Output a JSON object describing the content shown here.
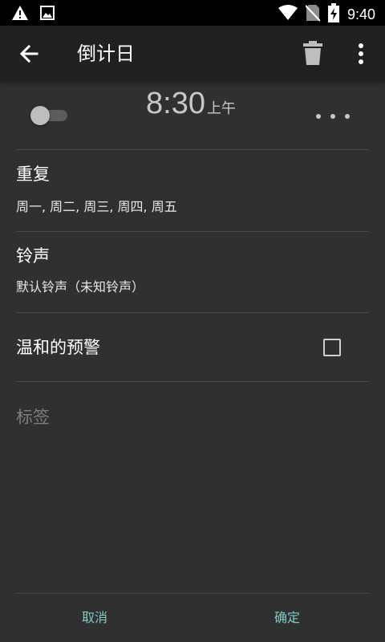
{
  "status_bar": {
    "time": "9:40",
    "icons": [
      "warning-icon",
      "image-icon",
      "wifi-icon",
      "no-sim-icon",
      "battery-charging-icon"
    ]
  },
  "toolbar": {
    "title": "倒计日",
    "back_icon": "arrow-left-icon",
    "delete_icon": "trash-icon",
    "more_icon": "more-vert-icon"
  },
  "alarm": {
    "enabled": false,
    "time": "8:30",
    "ampm": "上午"
  },
  "repeat": {
    "title": "重复",
    "value": "周一, 周二, 周三, 周四, 周五"
  },
  "ringtone": {
    "title": "铃声",
    "value": "默认铃声（未知铃声）"
  },
  "gentle_alarm": {
    "title": "温和的预警",
    "checked": false
  },
  "label": {
    "placeholder": "标签",
    "value": ""
  },
  "actions": {
    "cancel": "取消",
    "confirm": "确定"
  },
  "colors": {
    "background": "#303030",
    "toolbar": "#212121",
    "accent": "#80cbc4",
    "status_bar": "#000000"
  }
}
